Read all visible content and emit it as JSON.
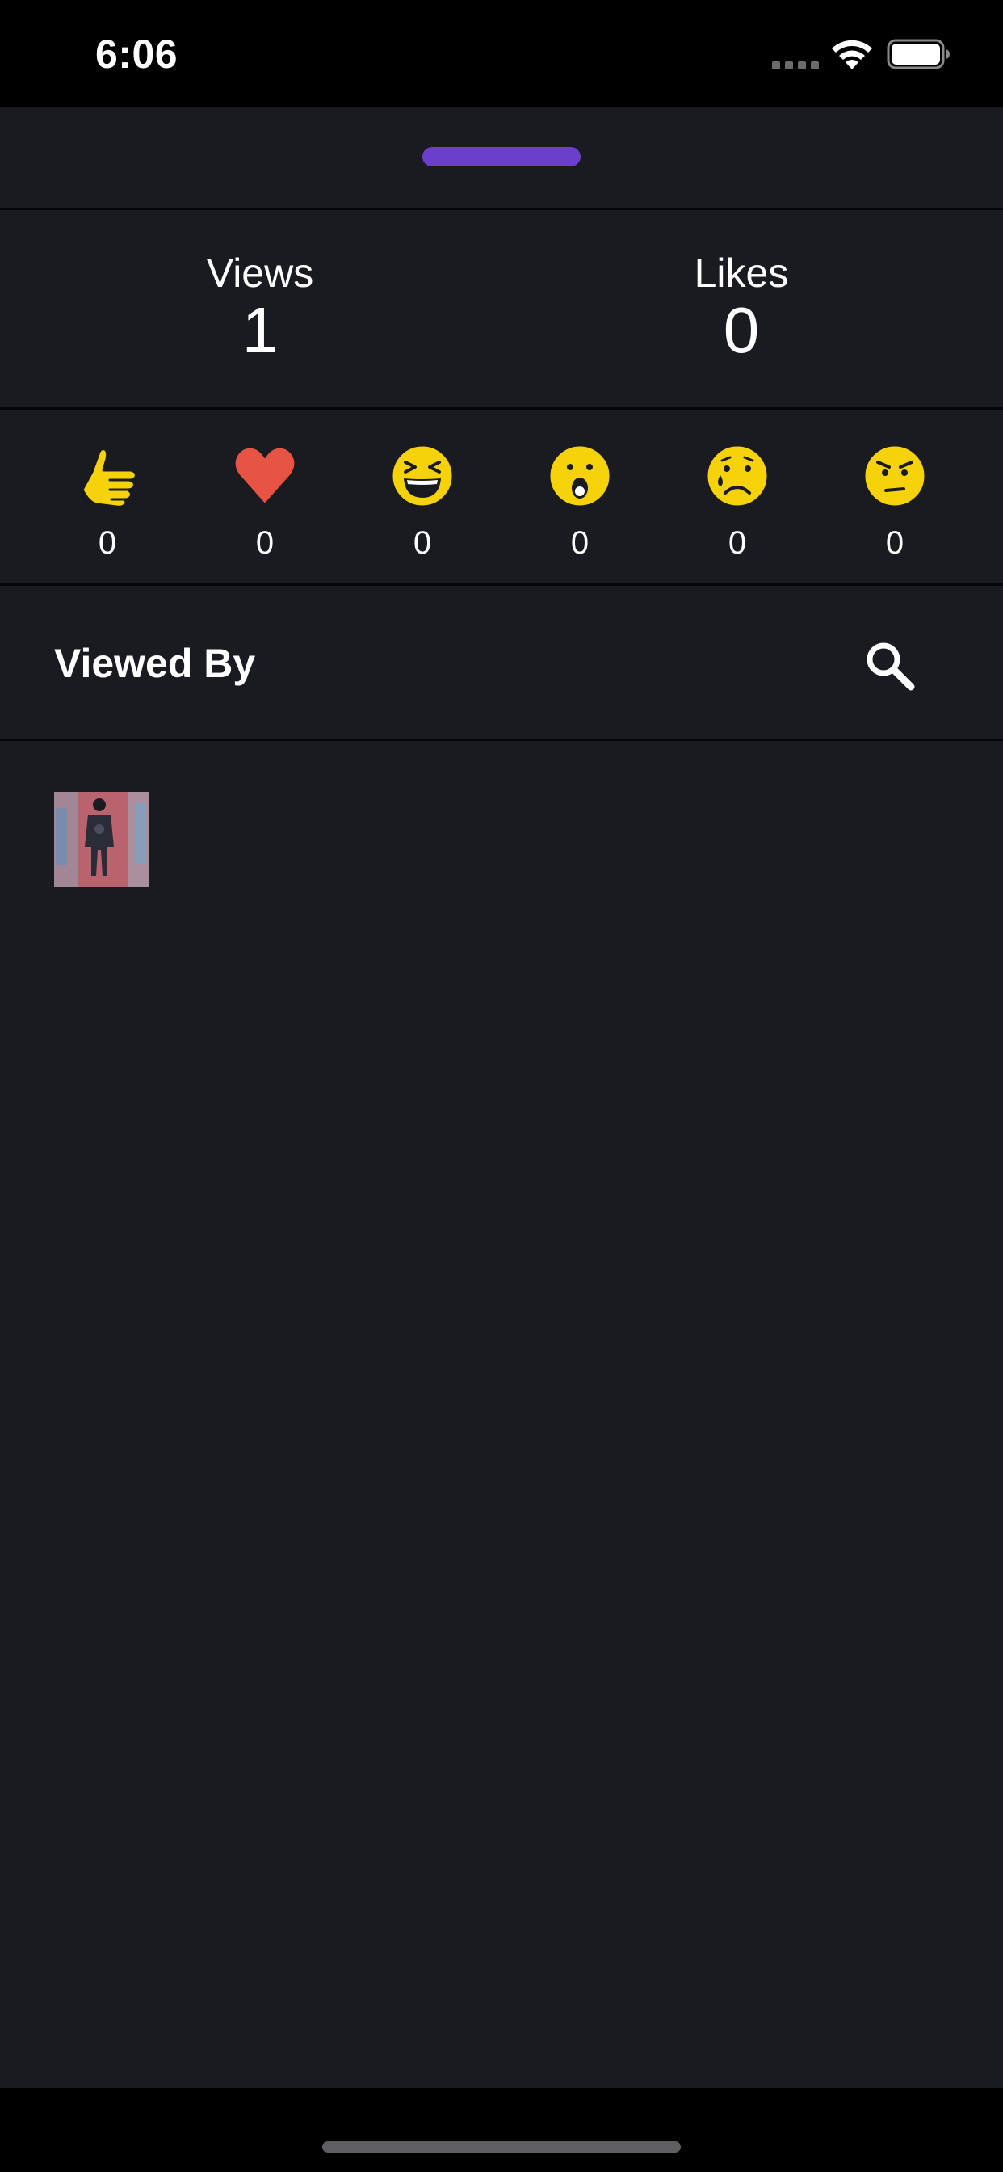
{
  "status_bar": {
    "time": "6:06",
    "signal_icon": "cellular-dots-icon",
    "wifi_icon": "wifi-icon",
    "battery_icon": "battery-full-icon"
  },
  "colors": {
    "background": "#1a1b20",
    "divider": "#07070a",
    "handle": "#6b3fc9",
    "emoji_yellow": "#f5d20a",
    "heart_red": "#e85443"
  },
  "stats": {
    "views_label": "Views",
    "views_value": "1",
    "likes_label": "Likes",
    "likes_value": "0"
  },
  "reactions": [
    {
      "icon": "thumbs-up-icon",
      "count": "0"
    },
    {
      "icon": "heart-icon",
      "count": "0"
    },
    {
      "icon": "laughing-face-icon",
      "count": "0"
    },
    {
      "icon": "surprised-face-icon",
      "count": "0"
    },
    {
      "icon": "sad-face-icon",
      "count": "0"
    },
    {
      "icon": "angry-face-icon",
      "count": "0"
    }
  ],
  "viewed_by": {
    "title": "Viewed By",
    "search_icon": "search-icon",
    "viewers": [
      {
        "avatar": "viewer-avatar"
      }
    ]
  }
}
